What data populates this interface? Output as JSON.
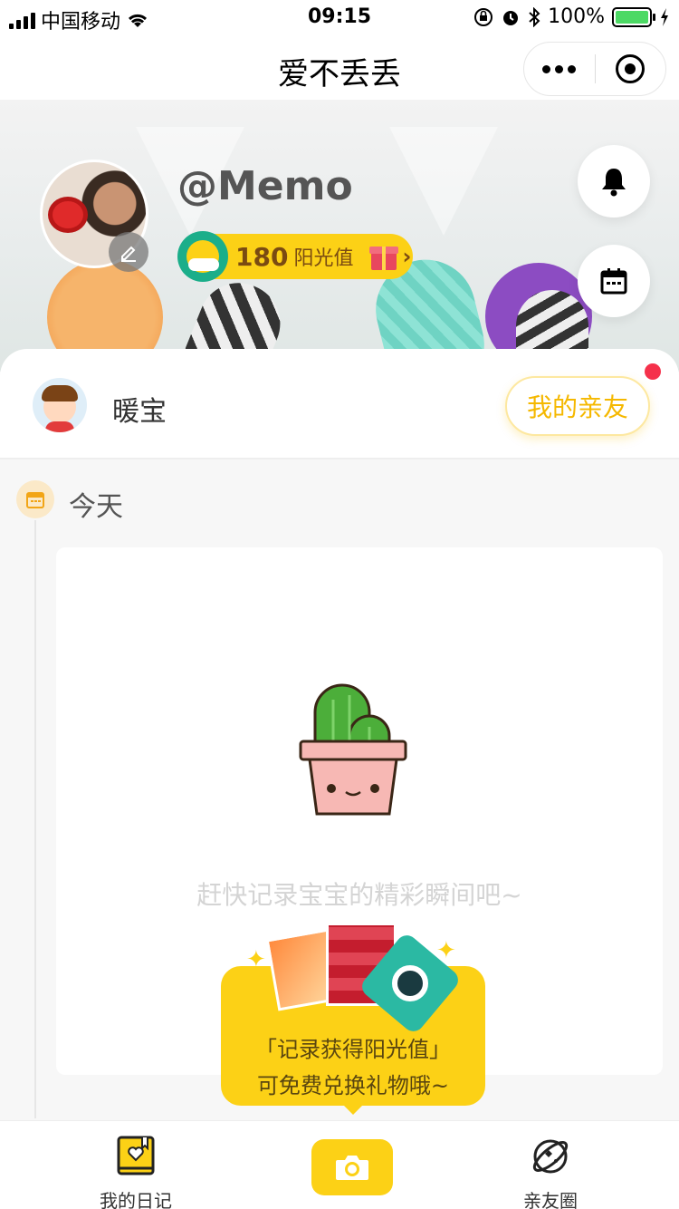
{
  "status_bar": {
    "carrier": "中国移动",
    "time": "09:15",
    "battery": "100%"
  },
  "navbar": {
    "title": "爱不丢丢"
  },
  "profile": {
    "username": "@Memo",
    "sunshine_value": "180",
    "sunshine_label": "阳光值"
  },
  "baby": {
    "name": "暖宝",
    "friends_button": "我的亲友"
  },
  "timeline": {
    "today_label": "今天",
    "empty_text": "赶快记录宝宝的精彩瞬间吧~"
  },
  "promo": {
    "line1": "「记录获得阳光值」",
    "line2": "可免费兑换礼物哦~"
  },
  "tabbar": {
    "diary_label": "我的日记",
    "friends_label": "亲友圈"
  },
  "colors": {
    "accent": "#fcd116",
    "friends_text": "#f5b800",
    "notification_dot": "#f5314b",
    "teal": "#1bae8a"
  },
  "icons": {
    "bell": "bell-icon",
    "calendar": "calendar-icon",
    "edit": "edit-icon",
    "camera": "camera-icon",
    "diary": "diary-book-icon",
    "friends_circle": "planet-icon"
  }
}
